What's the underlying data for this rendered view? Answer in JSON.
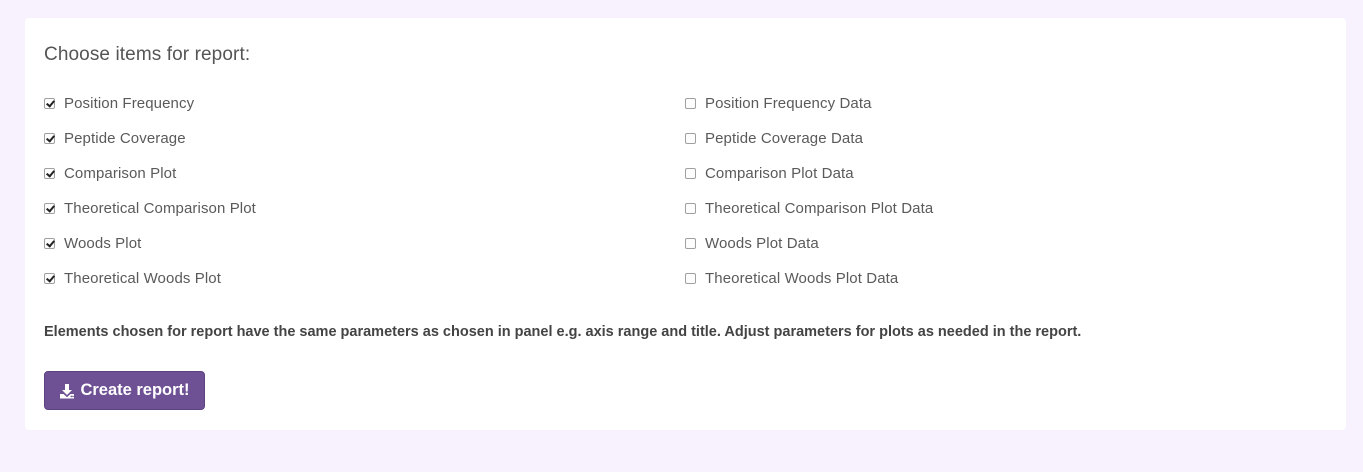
{
  "report": {
    "title": "Choose items for report:",
    "left_items": [
      {
        "label": "Position Frequency",
        "checked": true
      },
      {
        "label": "Peptide Coverage",
        "checked": true
      },
      {
        "label": "Comparison Plot",
        "checked": true
      },
      {
        "label": "Theoretical Comparison Plot",
        "checked": true
      },
      {
        "label": "Woods Plot",
        "checked": true
      },
      {
        "label": "Theoretical Woods Plot",
        "checked": true
      }
    ],
    "right_items": [
      {
        "label": "Position Frequency Data",
        "checked": false
      },
      {
        "label": "Peptide Coverage Data",
        "checked": false
      },
      {
        "label": "Comparison Plot Data",
        "checked": false
      },
      {
        "label": "Theoretical Comparison Plot Data",
        "checked": false
      },
      {
        "label": "Woods Plot Data",
        "checked": false
      },
      {
        "label": "Theoretical Woods Plot Data",
        "checked": false
      }
    ],
    "note": "Elements chosen for report have the same parameters as chosen in panel e.g. axis range and title. Adjust parameters for plots as needed in the report.",
    "button_label": "Create report!",
    "button_icon": "download-icon"
  },
  "colors": {
    "page_background": "#f7f2fd",
    "panel_background": "#ffffff",
    "button": "#6e5194"
  }
}
